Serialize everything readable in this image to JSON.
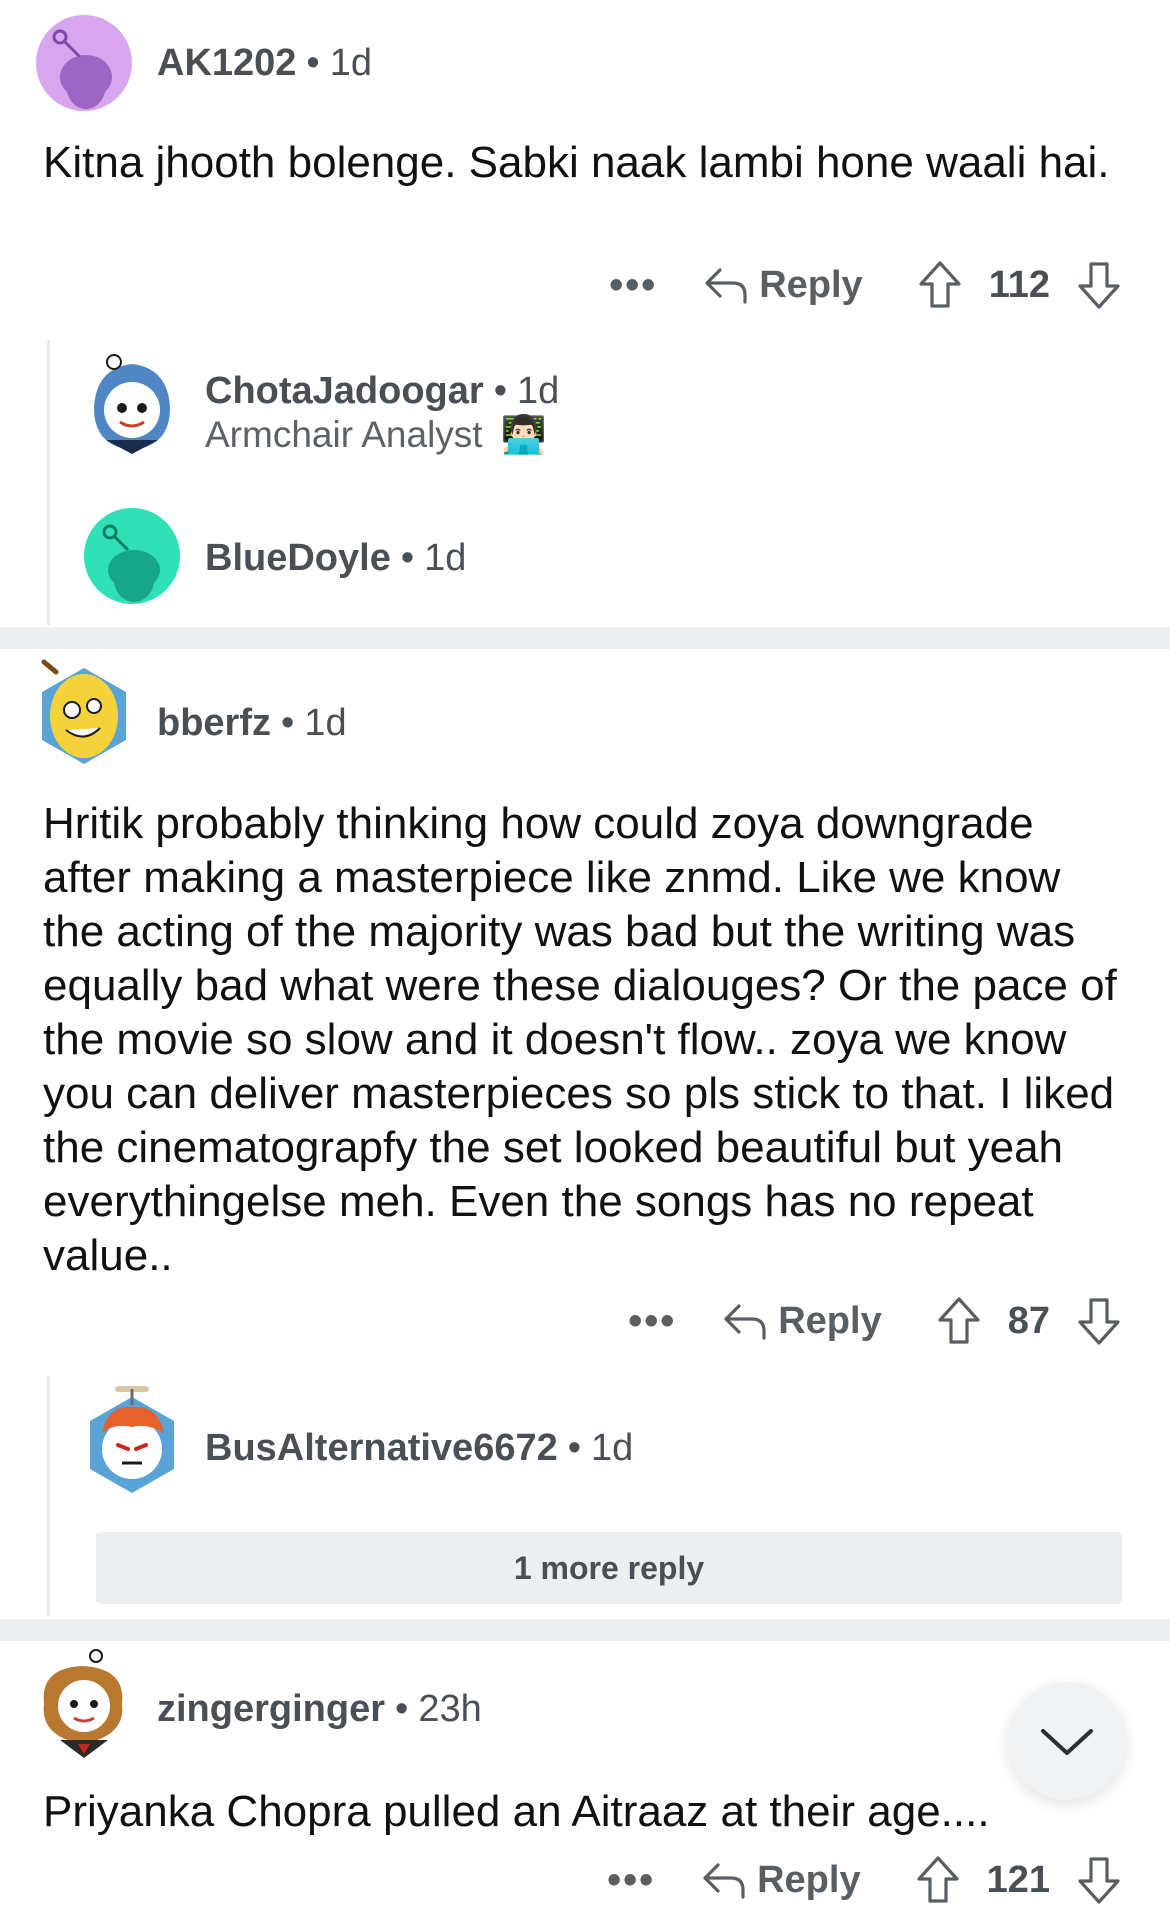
{
  "comments": [
    {
      "username": "AK1202",
      "age": "1d",
      "body": "Kitna jhooth bolenge. Sabki naak lambi hone waali hai.",
      "reply_label": "Reply",
      "more_label": "•••",
      "votes": "112",
      "avatar_color": "#d8a6ef",
      "replies": [
        {
          "username": "ChotaJadoogar",
          "age": "1d",
          "flair": "Armchair Analyst",
          "flair_emoji": "👨🏻‍💻"
        },
        {
          "username": "BlueDoyle",
          "age": "1d",
          "avatar_color": "#2fe0b6"
        }
      ]
    },
    {
      "username": "bberfz",
      "age": "1d",
      "body": "Hritik probably thinking how could zoya downgrade after making a masterpiece like znmd. Like we know the acting of the majority was bad but the writing was equally bad what were these dialouges? Or the pace of the movie so slow and it doesn't flow.. zoya we know you can deliver masterpieces so pls stick to that. I liked the cinematograpfy the set looked beautiful but yeah everythingelse meh. Even the songs has no repeat value..",
      "reply_label": "Reply",
      "more_label": "•••",
      "votes": "87",
      "replies": [
        {
          "username": "BusAlternative6672",
          "age": "1d"
        }
      ],
      "more_replies_label": "1 more reply"
    },
    {
      "username": "zingerginger",
      "age": "23h",
      "body": "Priyanka Chopra pulled an Aitraaz at their age....",
      "reply_label": "Reply",
      "more_label": "•••",
      "votes": "121"
    }
  ],
  "separator_dot": "•",
  "colors": {
    "text_primary": "#111111",
    "text_meta": "#4a4f55",
    "separator": "#eceef0",
    "thread_line": "#e7e8ea"
  },
  "icons": [
    "reply-arrow-icon",
    "upvote-arrow-icon",
    "downvote-arrow-icon",
    "chevron-down-icon",
    "overflow-menu-icon"
  ]
}
